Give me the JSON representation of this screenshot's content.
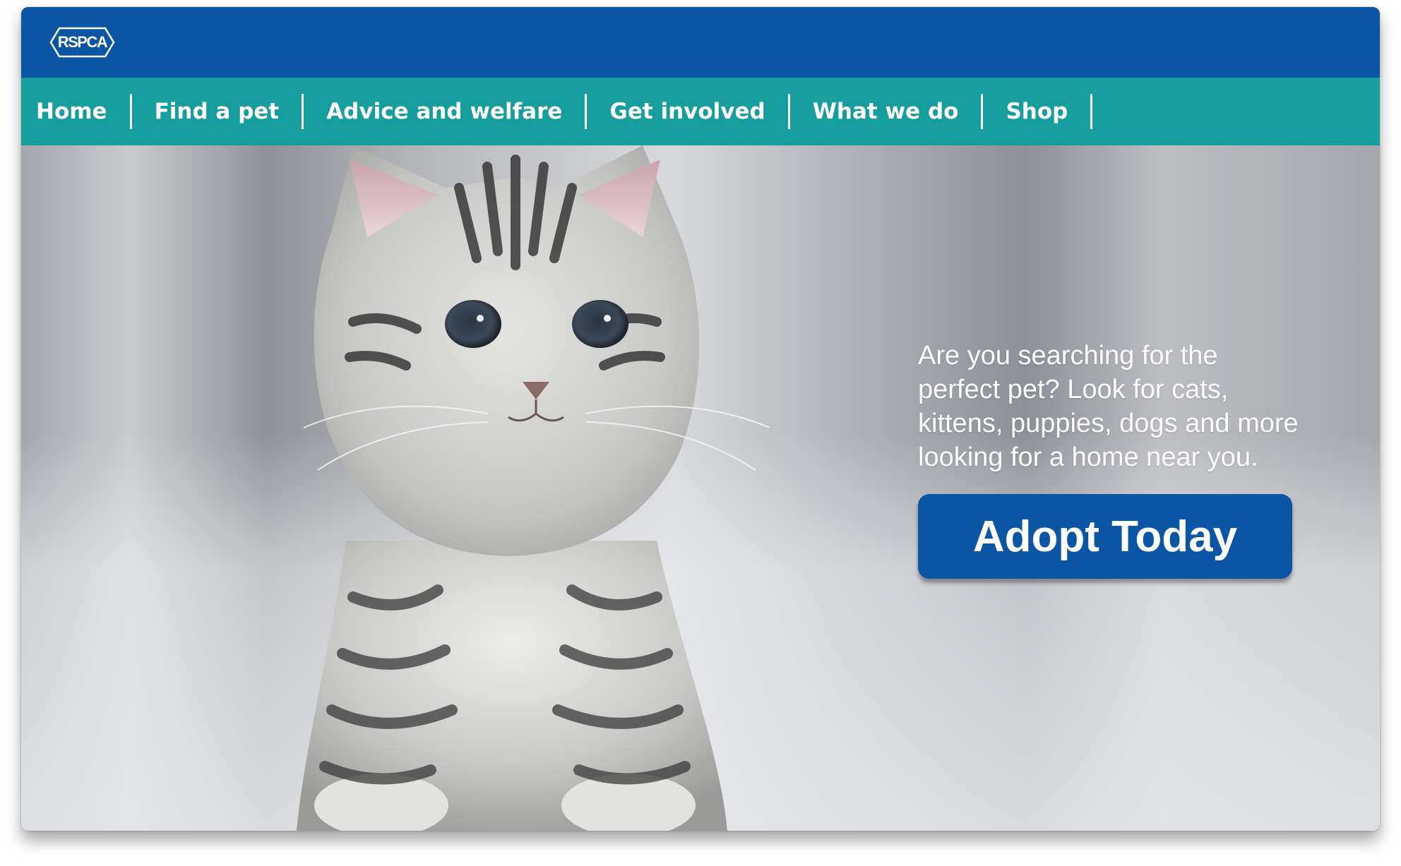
{
  "brand": {
    "logo_text": "RSPCA",
    "logo_icon": "rspca-logo",
    "colors": {
      "header_blue": "#0b56a4",
      "nav_teal": "#169e9f",
      "button_blue": "#0b56a4",
      "text_white": "#ffffff"
    }
  },
  "nav": {
    "items": [
      {
        "label": "Home"
      },
      {
        "label": "Find a pet"
      },
      {
        "label": "Advice and welfare"
      },
      {
        "label": "Get involved"
      },
      {
        "label": "What we do"
      },
      {
        "label": "Shop"
      }
    ]
  },
  "hero": {
    "image": "tabby-kitten-photo",
    "tagline": "Are you searching for the perfect pet? Look for cats, kittens, puppies, dogs and more looking for a home near you.",
    "cta_label": "Adopt Today"
  }
}
